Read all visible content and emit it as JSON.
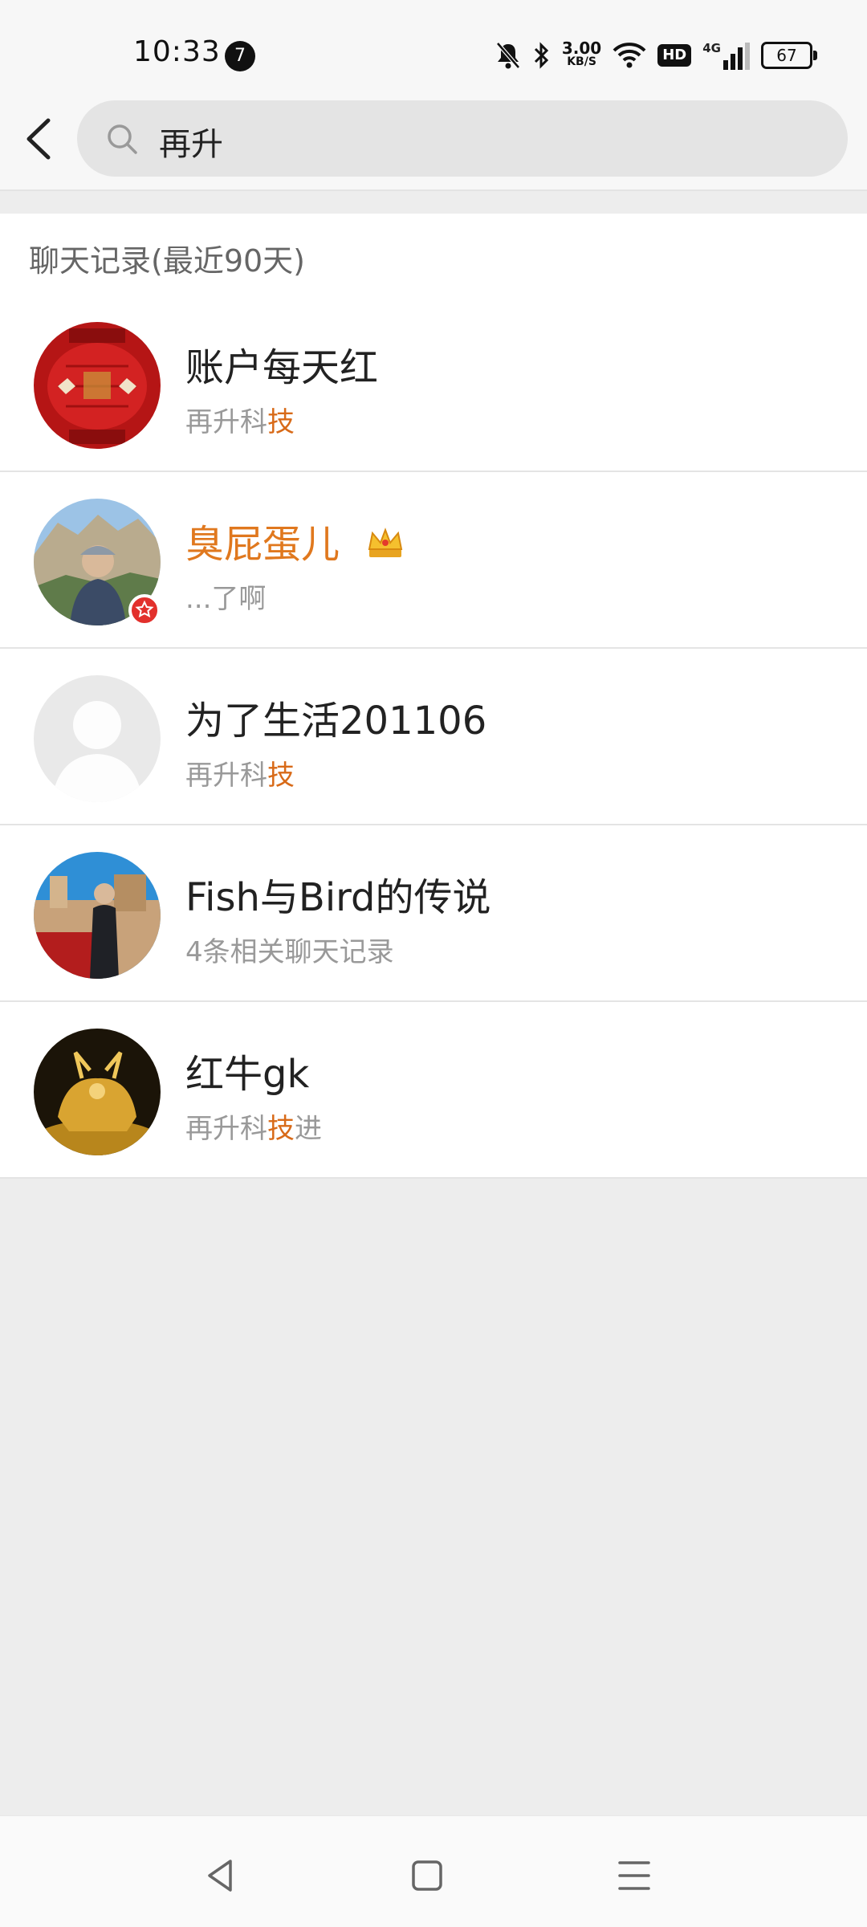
{
  "status_bar": {
    "time": "10:33",
    "notification_count": "7",
    "net_speed_value": "3.00",
    "net_speed_unit": "KB/S",
    "hd_label": "HD",
    "signal_label": "4G",
    "battery": "67"
  },
  "search": {
    "value": "再升",
    "icon": "search-icon"
  },
  "section": {
    "title": "聊天记录(最近90天)"
  },
  "results": [
    {
      "name": "账户每天红",
      "sub_pre": "再升科",
      "sub_hl": "技",
      "sub_post": ""
    },
    {
      "name": "臭屁蛋儿",
      "sub": "...了啊"
    },
    {
      "name": "为了生活201106",
      "sub_pre": "再升科",
      "sub_hl": "技",
      "sub_post": ""
    },
    {
      "name": "Fish与Bird的传说",
      "sub": "4条相关聊天记录"
    },
    {
      "name": "红牛gk",
      "sub_pre": "再升科",
      "sub_hl": "技",
      "sub_post": "进"
    }
  ],
  "colors": {
    "accent": "#d86a18",
    "background": "#ededed"
  }
}
